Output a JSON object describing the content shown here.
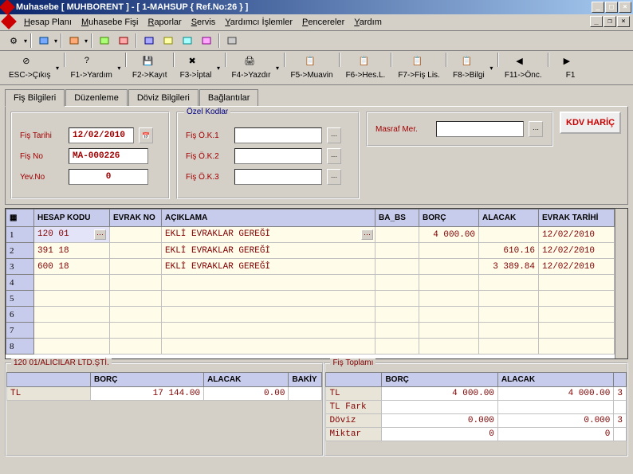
{
  "title": "Muhasebe [ MUHBORENT ]  - [ 1-MAHSUP { Ref.No:26 } ]",
  "menu": [
    "Hesap Planı",
    "Muhasebe Fişi",
    "Raporlar",
    "Servis",
    "Yardımcı İşlemler",
    "Pencereler",
    "Yardım"
  ],
  "toolbar_big": [
    {
      "label": "ESC->Çıkış",
      "drop": true
    },
    {
      "label": "F1->Yardım",
      "drop": true
    },
    {
      "label": "F2->Kayıt",
      "drop": false
    },
    {
      "label": "F3->İptal",
      "drop": true
    },
    {
      "label": "F4->Yazdır",
      "drop": true
    },
    {
      "label": "F5->Muavin",
      "drop": false
    },
    {
      "label": "F6->Hes.L.",
      "drop": false
    },
    {
      "label": "F7->Fiş Lis.",
      "drop": false
    },
    {
      "label": "F8->Bilgi",
      "drop": true
    },
    {
      "label": "F11->Önc.",
      "drop": false
    },
    {
      "label": "F1",
      "drop": false
    }
  ],
  "tabs": [
    "Fiş Bilgileri",
    "Düzenleme",
    "Döviz Bilgileri",
    "Bağlantılar"
  ],
  "fields": {
    "fis_tarihi_label": "Fiş Tarihi",
    "fis_tarihi": "12/02/2010",
    "fis_no_label": "Fiş No",
    "fis_no": "MA-000226",
    "yev_no_label": "Yev.No",
    "yev_no": "0",
    "ozel_kodlar_label": "Özel Kodlar",
    "fis_ok1_label": "Fiş Ö.K.1",
    "fis_ok1": "",
    "fis_ok2_label": "Fiş Ö.K.2",
    "fis_ok2": "",
    "fis_ok3_label": "Fiş Ö.K.3",
    "fis_ok3": "",
    "masraf_mer_label": "Masraf Mer.",
    "masraf_mer": "",
    "kdv_label": "KDV HARİÇ"
  },
  "grid": {
    "headers": [
      "",
      "HESAP KODU",
      "EVRAK NO",
      "AÇIKLAMA",
      "BA_BS",
      "BORÇ",
      "ALACAK",
      "EVRAK TARİHİ"
    ],
    "rows": [
      {
        "n": "1",
        "hesap": "120 01",
        "evrak": "",
        "aciklama": "EKLİ EVRAKLAR GEREĞİ",
        "babs": "",
        "borc": "4 000.00",
        "alacak": "",
        "tarih": "12/02/2010"
      },
      {
        "n": "2",
        "hesap": "391 18",
        "evrak": "",
        "aciklama": "EKLİ EVRAKLAR GEREĞİ",
        "babs": "",
        "borc": "",
        "alacak": "610.16",
        "tarih": "12/02/2010"
      },
      {
        "n": "3",
        "hesap": "600 18",
        "evrak": "",
        "aciklama": "EKLİ EVRAKLAR GEREĞİ",
        "babs": "",
        "borc": "",
        "alacak": "3 389.84",
        "tarih": "12/02/2010"
      },
      {
        "n": "4"
      },
      {
        "n": "5"
      },
      {
        "n": "6"
      },
      {
        "n": "7"
      },
      {
        "n": "8"
      }
    ]
  },
  "bottom_left": {
    "title": "120 01/ALICILAR LTD.ŞTİ.",
    "headers": [
      "",
      "BORÇ",
      "ALACAK",
      "BAKİY"
    ],
    "rows": [
      {
        "lbl": "TL",
        "borc": "17 144.00",
        "alacak": "0.00",
        "bakiye": ""
      }
    ]
  },
  "bottom_right": {
    "title": "Fiş Toplamı",
    "headers": [
      "",
      "BORÇ",
      "ALACAK"
    ],
    "rows": [
      {
        "lbl": "TL",
        "borc": "4 000.00",
        "alacak": "4 000.00",
        "extra": "3"
      },
      {
        "lbl": "TL Fark",
        "borc": "",
        "alacak": ""
      },
      {
        "lbl": "Döviz",
        "borc": "0.000",
        "alacak": "0.000",
        "extra": "3"
      },
      {
        "lbl": "Miktar",
        "borc": "0",
        "alacak": "0"
      }
    ]
  }
}
